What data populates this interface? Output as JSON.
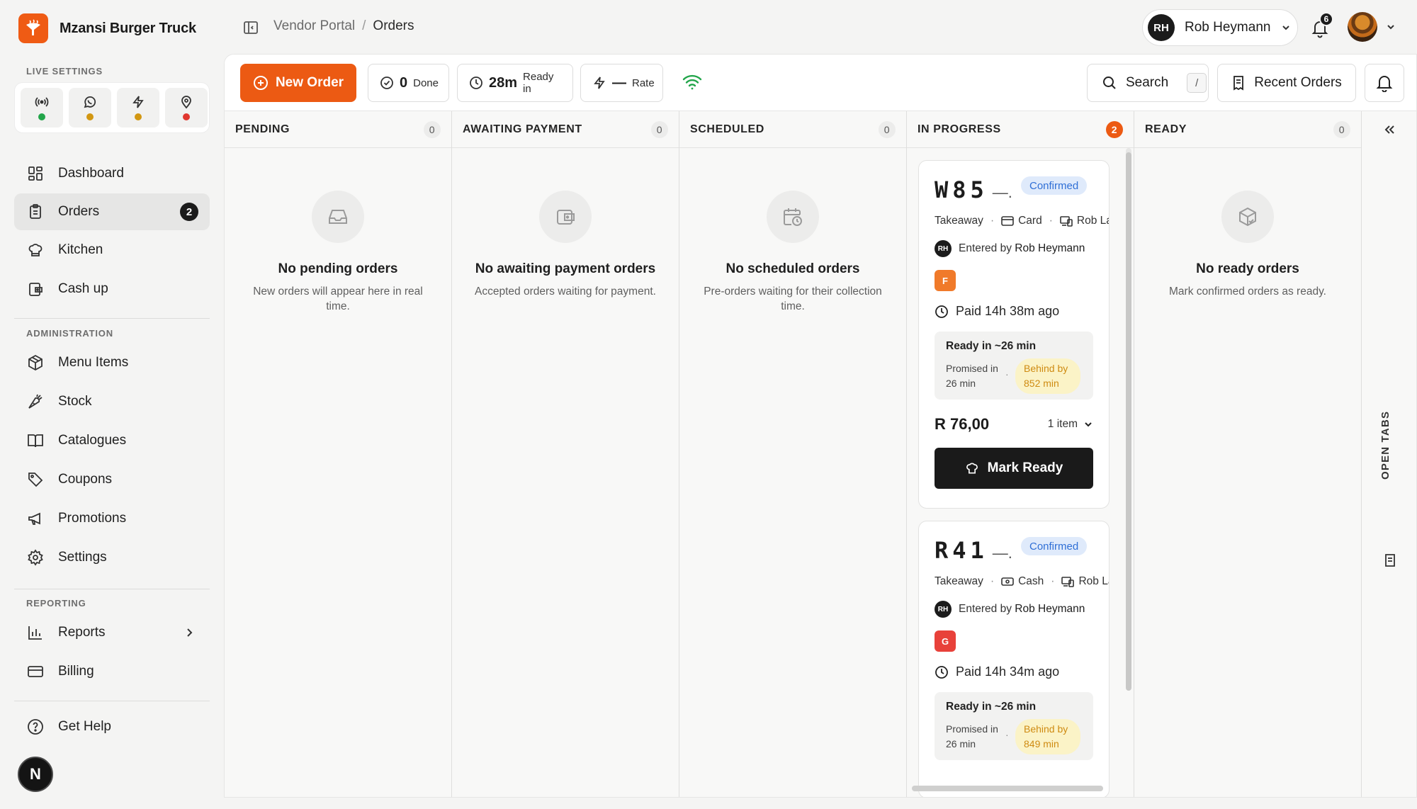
{
  "brand": {
    "name": "Mzansi Burger Truck"
  },
  "breadcrumb": {
    "root": "Vendor Portal",
    "separator": "/",
    "current": "Orders"
  },
  "user": {
    "initials": "RH",
    "name": "Rob Heymann",
    "notifications": "6"
  },
  "sidebar": {
    "live_settings_label": "LIVE SETTINGS",
    "live_settings": [
      {
        "icon": "broadcast-icon",
        "status_color": "#22a54a"
      },
      {
        "icon": "whatsapp-icon",
        "status_color": "#d29712"
      },
      {
        "icon": "lightning-icon",
        "status_color": "#d29712"
      },
      {
        "icon": "location-pin-icon",
        "status_color": "#e0372f"
      }
    ],
    "main_items": [
      {
        "label": "Dashboard",
        "icon": "dashboard-icon"
      },
      {
        "label": "Orders",
        "icon": "clipboard-icon",
        "badge": "2",
        "active": true
      },
      {
        "label": "Kitchen",
        "icon": "chef-hat-icon"
      },
      {
        "label": "Cash up",
        "icon": "wallet-icon"
      }
    ],
    "administration_label": "ADMINISTRATION",
    "admin_items": [
      {
        "label": "Menu Items",
        "icon": "box-icon"
      },
      {
        "label": "Stock",
        "icon": "carrot-icon"
      },
      {
        "label": "Catalogues",
        "icon": "book-icon"
      },
      {
        "label": "Coupons",
        "icon": "tag-icon"
      },
      {
        "label": "Promotions",
        "icon": "megaphone-icon"
      },
      {
        "label": "Settings",
        "icon": "gear-icon"
      }
    ],
    "reporting_label": "REPORTING",
    "reporting_items": [
      {
        "label": "Reports",
        "icon": "bar-chart-icon"
      },
      {
        "label": "Billing",
        "icon": "credit-card-icon"
      }
    ],
    "help": {
      "label": "Get Help",
      "icon": "help-circle-icon"
    },
    "footer_logo": "N"
  },
  "toolbar": {
    "new_order": "New Order",
    "done": {
      "value": "0",
      "label": "Done"
    },
    "ready_in": {
      "value": "28m",
      "label": "Ready in"
    },
    "rate": {
      "value": "—",
      "label": "Rate"
    },
    "search": "Search",
    "search_shortcut": "/",
    "recent_orders": "Recent Orders"
  },
  "columns": [
    {
      "title": "PENDING",
      "count": "0",
      "empty_title": "No pending orders",
      "empty_desc": "New orders will appear here in real time."
    },
    {
      "title": "AWAITING PAYMENT",
      "count": "0",
      "empty_title": "No awaiting payment orders",
      "empty_desc": "Accepted orders waiting for payment."
    },
    {
      "title": "SCHEDULED",
      "count": "0",
      "empty_title": "No scheduled orders",
      "empty_desc": "Pre-orders waiting for their collection time."
    },
    {
      "title": "IN PROGRESS",
      "count": "2"
    },
    {
      "title": "READY",
      "count": "0",
      "empty_title": "No ready orders",
      "empty_desc": "Mark confirmed orders as ready."
    }
  ],
  "orders": [
    {
      "code": "W85",
      "dash": "—.",
      "status": "Confirmed",
      "type": "Takeaway",
      "payment": "Card",
      "device": "Rob Lapt",
      "entered_prefix": "Entered by",
      "entered_by": "Rob Heymann",
      "entered_initials": "RH",
      "tag": "F",
      "tag_color": "#f07a2a",
      "paid": "Paid 14h 38m ago",
      "ready_title": "Ready in ~26 min",
      "promised": "Promised in 26 min",
      "behind": "Behind by 852 min",
      "price": "R 76,00",
      "items": "1 item",
      "action": "Mark Ready"
    },
    {
      "code": "R41",
      "dash": "—.",
      "status": "Confirmed",
      "type": "Takeaway",
      "payment": "Cash",
      "device": "Rob Lap",
      "entered_prefix": "Entered by",
      "entered_by": "Rob Heymann",
      "entered_initials": "RH",
      "tag": "G",
      "tag_color": "#e8413a",
      "paid": "Paid 14h 34m ago",
      "ready_title": "Ready in ~26 min",
      "promised": "Promised in 26 min",
      "behind": "Behind by 849 min"
    }
  ],
  "right_rail": {
    "label": "OPEN TABS"
  },
  "colors": {
    "accent": "#ec5a13",
    "confirmed_bg": "#dfeafb",
    "confirmed_text": "#2f6fd6",
    "behind_bg": "#fbf3c7",
    "behind_text": "#cf8b12"
  }
}
